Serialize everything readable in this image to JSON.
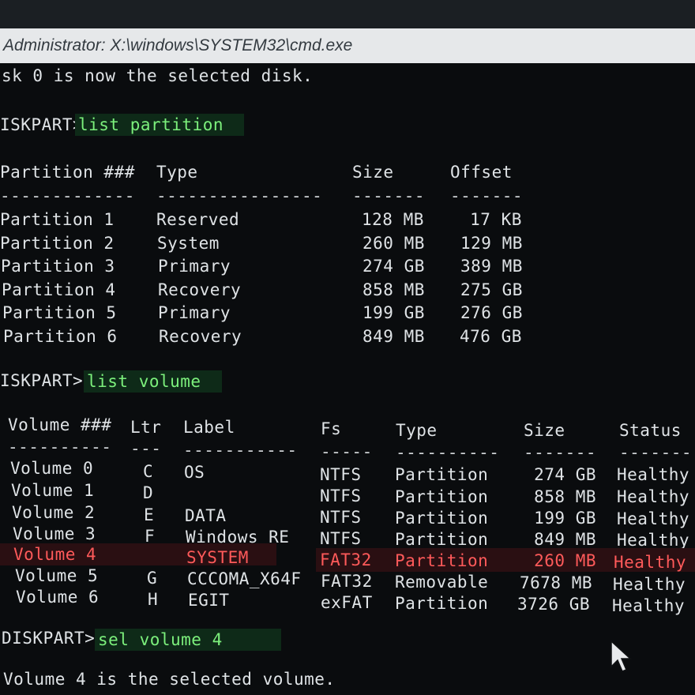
{
  "window": {
    "title": "Administrator: X:\\windows\\SYSTEM32\\cmd.exe"
  },
  "console": {
    "line1": "sk 0 is now the selected disk.",
    "prompt1": "ISKPART>",
    "cmd1": "list partition",
    "partition_headers": [
      "Partition ###",
      "Type",
      "Size",
      "Offset"
    ],
    "partition_dashes": [
      "-------------",
      "----------------",
      "-------",
      "-------"
    ],
    "partitions": [
      {
        "name": "Partition 1",
        "type": "Reserved",
        "size": "128 MB",
        "offset": " 17 KB"
      },
      {
        "name": "Partition 2",
        "type": "System",
        "size": "260 MB",
        "offset": "129 MB"
      },
      {
        "name": "Partition 3",
        "type": "Primary",
        "size": "274 GB",
        "offset": "389 MB"
      },
      {
        "name": "Partition 4",
        "type": "Recovery",
        "size": "858 MB",
        "offset": "275 GB"
      },
      {
        "name": "Partition 5",
        "type": "Primary",
        "size": "199 GB",
        "offset": "276 GB"
      },
      {
        "name": "Partition 6",
        "type": "Recovery",
        "size": "849 MB",
        "offset": "476 GB"
      }
    ],
    "prompt2": "ISKPART>",
    "cmd2": "list volume",
    "volume_headers": [
      "Volume ###",
      "Ltr",
      "Label",
      "Fs",
      "Type",
      "Size",
      "Status"
    ],
    "volume_dashes": [
      "----------",
      "---",
      "-----------",
      "-----",
      "----------",
      "-------",
      "-------"
    ],
    "volumes": [
      {
        "name": "Volume 0",
        "ltr": "C",
        "label": "OS",
        "fs": "NTFS",
        "type": "Partition",
        "size": " 274 GB",
        "status": "Healthy"
      },
      {
        "name": "Volume 1",
        "ltr": "D",
        "label": "",
        "fs": "NTFS",
        "type": "Partition",
        "size": " 858 MB",
        "status": "Healthy"
      },
      {
        "name": "Volume 2",
        "ltr": "E",
        "label": "DATA",
        "fs": "NTFS",
        "type": "Partition",
        "size": " 199 GB",
        "status": "Healthy"
      },
      {
        "name": "Volume 3",
        "ltr": "F",
        "label": "Windows RE",
        "fs": "NTFS",
        "type": "Partition",
        "size": " 849 MB",
        "status": "Healthy"
      },
      {
        "name": "Volume 4",
        "ltr": "",
        "label": "SYSTEM",
        "fs": "FAT32",
        "type": "Partition",
        "size": " 260 MB",
        "status": "Healthy"
      },
      {
        "name": "Volume 5",
        "ltr": "G",
        "label": "CCCOMA_X64F",
        "fs": "FAT32",
        "type": "Removable",
        "size": "7678 MB",
        "status": "Healthy"
      },
      {
        "name": "Volume 6",
        "ltr": "H",
        "label": "EGIT",
        "fs": "exFAT",
        "type": "Partition",
        "size": "3726 GB",
        "status": "Healthy"
      }
    ],
    "prompt3": "DISKPART>",
    "cmd3": "sel volume 4",
    "last": "Volume 4 is the selected volume."
  },
  "colors": {
    "background": "#0a0c0e",
    "text": "#dfe3e6",
    "command": "#7cf07c",
    "highlight": "#ff5a5a",
    "titlebar": "#e6e8ea"
  },
  "icons": [
    "mouse-pointer-icon"
  ]
}
